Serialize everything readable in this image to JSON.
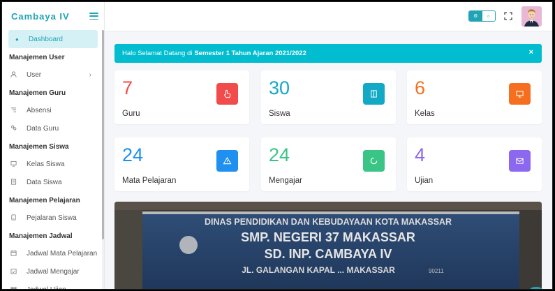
{
  "brand": {
    "name": "Cambaya IV"
  },
  "sidebar": {
    "dashboard": "Dashboard",
    "sections": [
      {
        "title": "Manajemen User",
        "items": [
          {
            "label": "User",
            "icon": "user-icon",
            "has_chevron": true
          }
        ]
      },
      {
        "title": "Manajemen Guru",
        "items": [
          {
            "label": "Absensi",
            "icon": "list-icon"
          },
          {
            "label": "Data Guru",
            "icon": "users-icon"
          }
        ]
      },
      {
        "title": "Manajemen Siswa",
        "items": [
          {
            "label": "Kelas Siswa",
            "icon": "monitor-icon"
          },
          {
            "label": "Data Siswa",
            "icon": "document-icon"
          }
        ]
      },
      {
        "title": "Manajemen Pelajaran",
        "items": [
          {
            "label": "Pejalaran Siswa",
            "icon": "tablet-icon"
          }
        ]
      },
      {
        "title": "Manajemen Jadwal",
        "items": [
          {
            "label": "Jadwal Mata Pelajaran",
            "icon": "calendar-icon"
          },
          {
            "label": "Jadwal Mengajar",
            "icon": "calendar-check-icon"
          },
          {
            "label": "Jadwal Ujian",
            "icon": "calendar-icon"
          }
        ]
      }
    ]
  },
  "alert": {
    "prefix": "Halo Selamat Datang di",
    "highlight": "Semester 1 Tahun Ajaran 2021/2022",
    "close": "×"
  },
  "stats": [
    {
      "value": "7",
      "label": "Guru",
      "color": "#f14b4b",
      "icon": "pointer-hand-icon"
    },
    {
      "value": "30",
      "label": "Siswa",
      "color": "#12a9c7",
      "icon": "book-icon"
    },
    {
      "value": "6",
      "label": "Kelas",
      "color": "#f56f1f",
      "icon": "monitor-icon"
    },
    {
      "value": "24",
      "label": "Mata Pelajaran",
      "color": "#1f8ff0",
      "icon": "warning-icon"
    },
    {
      "value": "24",
      "label": "Mengajar",
      "color": "#3ac485",
      "icon": "loader-icon"
    },
    {
      "value": "4",
      "label": "Ujian",
      "color": "#8c67f0",
      "icon": "mail-icon"
    }
  ],
  "banner": {
    "line1": "DINAS PENDIDIKAN DAN KEBUDAYAAN KOTA MAKASSAR",
    "line2": "SMP. NEGERI 37 MAKASSAR",
    "line3": "SD. INP. CAMBAYA IV",
    "line4": "JL. GALANGAN KAPAL ... MAKASSAR",
    "code": "90211"
  },
  "colors": {
    "accent": "#1fa3b5",
    "alert_bg": "#02bdd0"
  }
}
